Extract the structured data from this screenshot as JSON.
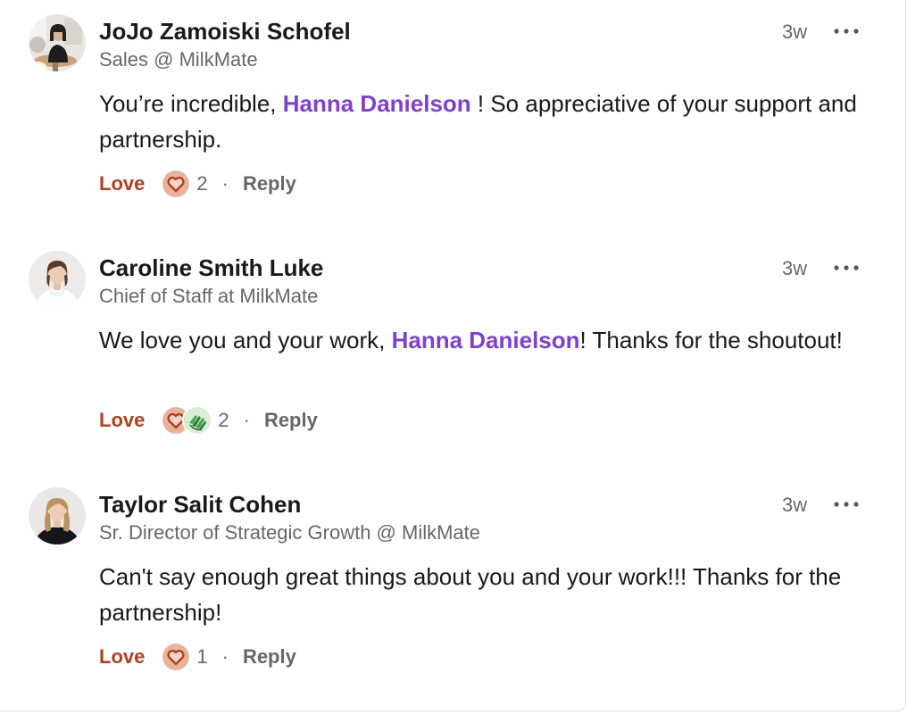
{
  "colors": {
    "mention": "#7f3fd0",
    "love": "#b24020",
    "love_icon_bg": "#e8b39d",
    "love_icon_stroke": "#b24020",
    "support_icon_bg": "#44a24c"
  },
  "comments": [
    {
      "name": "JoJo Zamoiski Schofel",
      "headline": "Sales @ MilkMate",
      "time": "3w",
      "text_before": "You’re incredible, ",
      "mention": "Hanna Danielson",
      "text_after": " ! So appreciative of your support and partnership.",
      "reaction_label": "Love",
      "reaction_icons": [
        "heart-icon"
      ],
      "reaction_count": "2",
      "separator": "·",
      "reply_label": "Reply"
    },
    {
      "name": "Caroline Smith Luke",
      "headline": "Chief of Staff at MilkMate",
      "time": "3w",
      "text_before": "We love you and your work, ",
      "mention": "Hanna Danielson",
      "text_after": "! Thanks for the shoutout!",
      "reaction_label": "Love",
      "reaction_icons": [
        "heart-icon",
        "support-hands-icon"
      ],
      "reaction_count": "2",
      "separator": "·",
      "reply_label": "Reply"
    },
    {
      "name": "Taylor Salit Cohen",
      "headline": "Sr. Director of Strategic Growth @ MilkMate",
      "time": "3w",
      "text_before": "Can't say enough great things about you and your work!!! Thanks for the partnership!",
      "mention": "",
      "text_after": "",
      "reaction_label": "Love",
      "reaction_icons": [
        "heart-icon"
      ],
      "reaction_count": "1",
      "separator": "·",
      "reply_label": "Reply"
    }
  ]
}
